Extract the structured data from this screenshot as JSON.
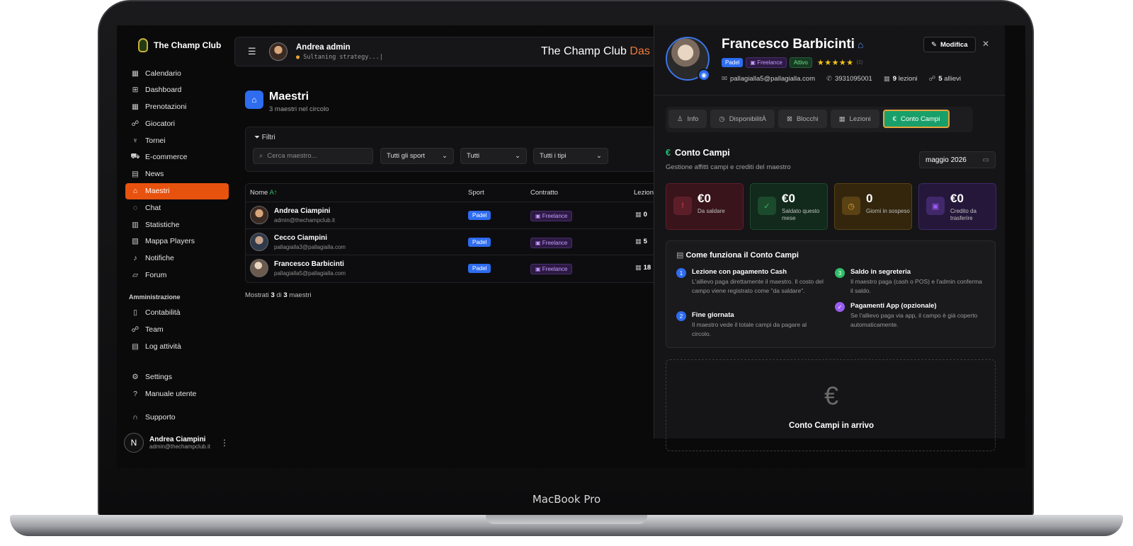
{
  "device": {
    "brand": "MacBook Pro"
  },
  "sidebar": {
    "app_name": "The Champ Club",
    "items": [
      {
        "label": "Calendario",
        "icon": "calendar-icon"
      },
      {
        "label": "Dashboard",
        "icon": "grid-icon"
      },
      {
        "label": "Prenotazioni",
        "icon": "calendar-check-icon"
      },
      {
        "label": "Giocatori",
        "icon": "users-icon"
      },
      {
        "label": "Tornei",
        "icon": "trophy-icon"
      },
      {
        "label": "E-commerce",
        "icon": "cart-icon"
      },
      {
        "label": "News",
        "icon": "newspaper-icon"
      },
      {
        "label": "Maestri",
        "icon": "graduation-cap-icon"
      },
      {
        "label": "Chat",
        "icon": "chat-icon"
      },
      {
        "label": "Statistiche",
        "icon": "bar-chart-icon"
      },
      {
        "label": "Mappa Players",
        "icon": "map-icon"
      },
      {
        "label": "Notifiche",
        "icon": "bell-icon"
      },
      {
        "label": "Forum",
        "icon": "forum-icon"
      }
    ],
    "admin_label": "Amministrazione",
    "admin_items": [
      {
        "label": "Contabilità",
        "icon": "receipt-icon"
      },
      {
        "label": "Team",
        "icon": "team-icon"
      },
      {
        "label": "Log attività",
        "icon": "log-icon"
      }
    ],
    "settings": "Settings",
    "manual": "Manuale utente",
    "support": "Supporto",
    "user": {
      "initial": "N",
      "name": "Andrea Ciampini",
      "email": "admin@thechampclub.it"
    }
  },
  "header": {
    "user_name": "Andrea  admin",
    "status": "Sultaning strategy...|",
    "title_main": "The Champ Club ",
    "title_accent": "Das"
  },
  "main": {
    "title": "Maestri",
    "subtitle": "3 maestri nel circolo",
    "filters_label": "Filtri",
    "search_placeholder": "Cerca maestro...",
    "sport_select": "Tutti gli sport",
    "contract_select": "Tutti",
    "type_select": "Tutti i tipi",
    "columns": {
      "name": "Nome",
      "sort": "A↑",
      "sport": "Sport",
      "contract": "Contratto",
      "lessons": "Lezion"
    },
    "rows": [
      {
        "name": "Andrea Ciampini",
        "email": "admin@thechampclub.it",
        "sport": "Padel",
        "contract": "Freelance",
        "lessons": "0"
      },
      {
        "name": "Cecco Ciampini",
        "email": "pallagialla3@pallagialla.com",
        "sport": "Padel",
        "contract": "Freelance",
        "lessons": "5"
      },
      {
        "name": "Francesco Barbicinti",
        "email": "pallagialla5@pallagialla.com",
        "sport": "Padel",
        "contract": "Freelance",
        "lessons": "18"
      }
    ],
    "shown_prefix": "Mostrati ",
    "shown_count": "3",
    "shown_mid": " di ",
    "shown_total": "3",
    "shown_suffix": " maestri"
  },
  "panel": {
    "name": "Francesco Barbicinti",
    "badges": {
      "sport": "Padel",
      "contract": "Freelance",
      "status": "Attivo"
    },
    "rating_stars": "★★★★★",
    "rating_count": "(1)",
    "email": "pallagialla5@pallagialla.com",
    "phone": "3931095001",
    "lessons_count": "9",
    "lessons_label": "lezioni",
    "students_count": "5",
    "students_label": "allievi",
    "edit_label": "Modifica",
    "tabs": [
      {
        "label": "Info",
        "icon": "user-icon"
      },
      {
        "label": "DisponibilitÀ",
        "icon": "clock-icon"
      },
      {
        "label": "Blocchi",
        "icon": "calendar-x-icon"
      },
      {
        "label": "Lezioni",
        "icon": "calendar-icon"
      },
      {
        "label": "Conto Campi",
        "icon": "euro-icon"
      }
    ],
    "section_title": "Conto Campi",
    "section_subtitle": "Gestione affitti campi e crediti del maestro",
    "month": "maggio 2026",
    "kpis": [
      {
        "value": "€0",
        "label": "Da saldare",
        "color": "#e0405a"
      },
      {
        "value": "€0",
        "label": "Saldato questo mese",
        "color": "#2fbf6a"
      },
      {
        "value": "0",
        "label": "Giorni in sospeso",
        "color": "#e3a330"
      },
      {
        "value": "€0",
        "label": "Credito da trasferire",
        "color": "#9a5cf0"
      }
    ],
    "how_title": "Come funziona il Conto Campi",
    "steps": [
      {
        "num": "1",
        "title": "Lezione con pagamento Cash",
        "desc": "L'allievo paga direttamente il maestro. Il costo del campo viene registrato come \"da saldare\"."
      },
      {
        "num": "2",
        "title": "Fine giornata",
        "desc": "Il maestro vede il totale campi da pagare al circolo."
      },
      {
        "num": "3",
        "title": "Saldo in segreteria",
        "desc": "Il maestro paga (cash o POS) e l'admin conferma il saldo."
      },
      {
        "num": "✓",
        "title": "Pagamenti App (opzionale)",
        "desc": "Se l'allievo paga via app, il campo è già coperto automaticamente."
      }
    ],
    "coming_icon": "€",
    "coming_title": "Conto Campi in arrivo"
  }
}
